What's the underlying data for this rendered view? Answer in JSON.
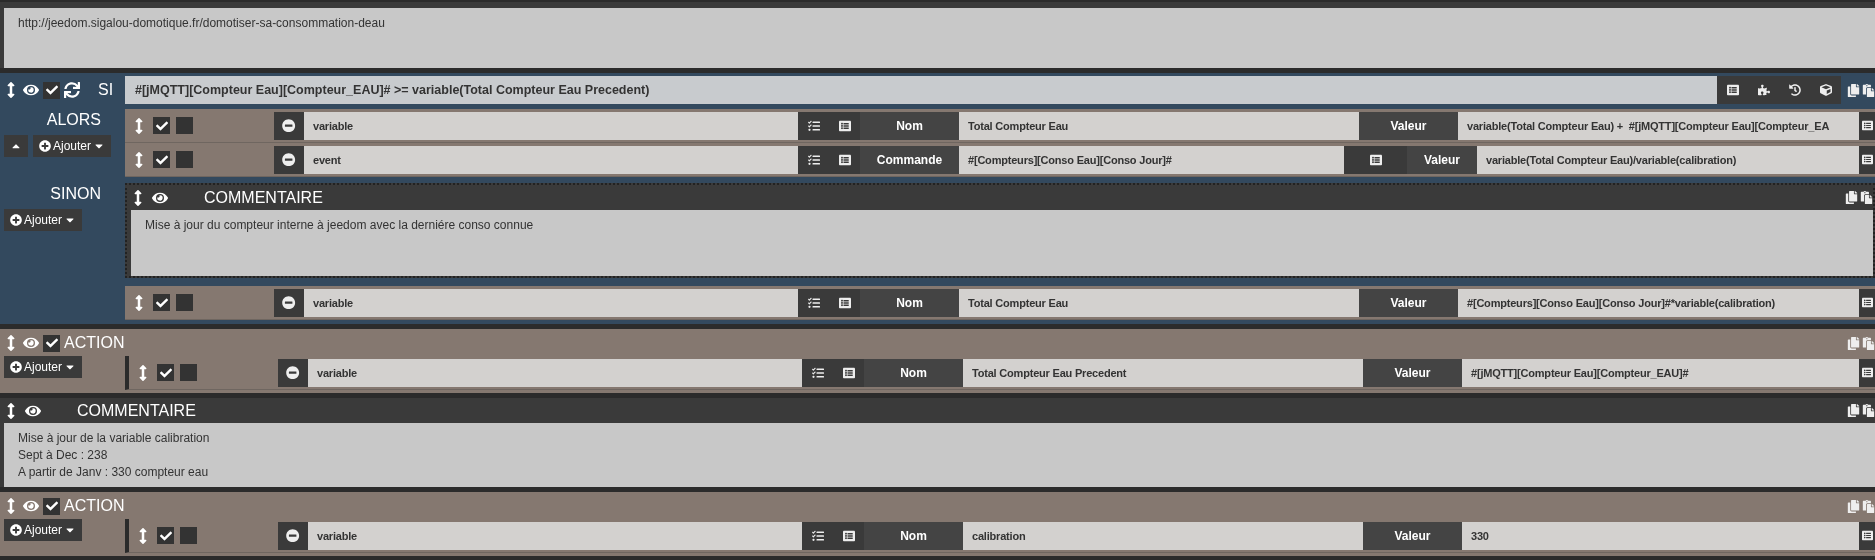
{
  "blocks": [
    {
      "kind": "comment",
      "lines": [
        "http://jeedom.sigalou-domotique.fr/domotiser-sa-consommation-deau"
      ]
    },
    {
      "kind": "if",
      "label": "SI",
      "checked": true,
      "condition": "#[jMQTT][Compteur Eau][Compteur_EAU]# >= variable(Total Compteur Eau Precedent)",
      "then_label": "ALORS",
      "then_add": "Ajouter",
      "then_items": [
        {
          "kind": "action",
          "checkboxes": [
            {
              "checked": true
            },
            {
              "checked": false
            }
          ],
          "command": "variable",
          "fields": [
            {
              "label": "Nom",
              "value": "Total Compteur Eau",
              "has_button": false
            },
            {
              "label": "Valeur",
              "value": "variable(Total Compteur Eau) +  #[jMQTT][Compteur Eau][Compteur_EA",
              "has_button": false
            }
          ]
        },
        {
          "kind": "action",
          "checkboxes": [
            {
              "checked": true
            },
            {
              "checked": false
            }
          ],
          "command": "event",
          "fields": [
            {
              "label": "Commande",
              "value": "#[Compteurs][Conso Eau][Conso Jour]#",
              "has_button": true
            },
            {
              "label": "Valeur",
              "value": "variable(Total Compteur Eau)/variable(calibration)",
              "has_button": false
            }
          ]
        }
      ],
      "else_label": "SINON",
      "else_add": "Ajouter",
      "else_items": [
        {
          "kind": "comment",
          "title": "COMMENTAIRE",
          "lines": [
            "Mise à jour du compteur interne à jeedom  avec la derniére conso connue"
          ]
        },
        {
          "kind": "action",
          "checkboxes": [
            {
              "checked": true
            },
            {
              "checked": false
            }
          ],
          "command": "variable",
          "fields": [
            {
              "label": "Nom",
              "value": "Total Compteur Eau",
              "has_button": false
            },
            {
              "label": "Valeur",
              "value": "#[Compteurs][Conso Eau][Conso Jour]#*variable(calibration)",
              "has_button": false
            }
          ]
        }
      ]
    },
    {
      "kind": "block",
      "title": "ACTION",
      "checked": true,
      "add": "Ajouter",
      "items": [
        {
          "kind": "action",
          "checkboxes": [
            {
              "checked": true
            },
            {
              "checked": false
            }
          ],
          "command": "variable",
          "fields": [
            {
              "label": "Nom",
              "value": "Total Compteur Eau Precedent",
              "has_button": false
            },
            {
              "label": "Valeur",
              "value": "#[jMQTT][Compteur Eau][Compteur_EAU]#",
              "has_button": false
            }
          ]
        }
      ]
    },
    {
      "kind": "comment",
      "title": "COMMENTAIRE",
      "lines": [
        "Mise à jour de la variable calibration",
        "Sept à Dec : 238",
        "A partir de Janv : 330 compteur eau"
      ]
    },
    {
      "kind": "block",
      "title": "ACTION",
      "checked": true,
      "add": "Ajouter",
      "items": [
        {
          "kind": "action",
          "checkboxes": [
            {
              "checked": true
            },
            {
              "checked": false
            }
          ],
          "command": "variable",
          "fields": [
            {
              "label": "Nom",
              "value": "calibration",
              "has_button": false
            },
            {
              "label": "Valeur",
              "value": "330",
              "has_button": false
            }
          ]
        }
      ]
    }
  ]
}
